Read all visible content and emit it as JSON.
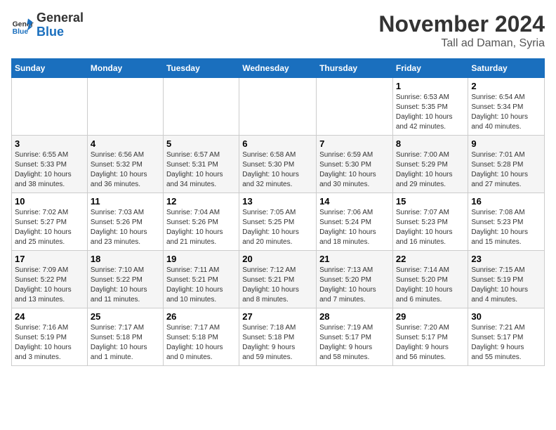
{
  "logo": {
    "line1": "General",
    "line2": "Blue"
  },
  "title": "November 2024",
  "subtitle": "Tall ad Daman, Syria",
  "days_of_week": [
    "Sunday",
    "Monday",
    "Tuesday",
    "Wednesday",
    "Thursday",
    "Friday",
    "Saturday"
  ],
  "weeks": [
    [
      {
        "day": "",
        "info": ""
      },
      {
        "day": "",
        "info": ""
      },
      {
        "day": "",
        "info": ""
      },
      {
        "day": "",
        "info": ""
      },
      {
        "day": "",
        "info": ""
      },
      {
        "day": "1",
        "info": "Sunrise: 6:53 AM\nSunset: 5:35 PM\nDaylight: 10 hours\nand 42 minutes."
      },
      {
        "day": "2",
        "info": "Sunrise: 6:54 AM\nSunset: 5:34 PM\nDaylight: 10 hours\nand 40 minutes."
      }
    ],
    [
      {
        "day": "3",
        "info": "Sunrise: 6:55 AM\nSunset: 5:33 PM\nDaylight: 10 hours\nand 38 minutes."
      },
      {
        "day": "4",
        "info": "Sunrise: 6:56 AM\nSunset: 5:32 PM\nDaylight: 10 hours\nand 36 minutes."
      },
      {
        "day": "5",
        "info": "Sunrise: 6:57 AM\nSunset: 5:31 PM\nDaylight: 10 hours\nand 34 minutes."
      },
      {
        "day": "6",
        "info": "Sunrise: 6:58 AM\nSunset: 5:30 PM\nDaylight: 10 hours\nand 32 minutes."
      },
      {
        "day": "7",
        "info": "Sunrise: 6:59 AM\nSunset: 5:30 PM\nDaylight: 10 hours\nand 30 minutes."
      },
      {
        "day": "8",
        "info": "Sunrise: 7:00 AM\nSunset: 5:29 PM\nDaylight: 10 hours\nand 29 minutes."
      },
      {
        "day": "9",
        "info": "Sunrise: 7:01 AM\nSunset: 5:28 PM\nDaylight: 10 hours\nand 27 minutes."
      }
    ],
    [
      {
        "day": "10",
        "info": "Sunrise: 7:02 AM\nSunset: 5:27 PM\nDaylight: 10 hours\nand 25 minutes."
      },
      {
        "day": "11",
        "info": "Sunrise: 7:03 AM\nSunset: 5:26 PM\nDaylight: 10 hours\nand 23 minutes."
      },
      {
        "day": "12",
        "info": "Sunrise: 7:04 AM\nSunset: 5:26 PM\nDaylight: 10 hours\nand 21 minutes."
      },
      {
        "day": "13",
        "info": "Sunrise: 7:05 AM\nSunset: 5:25 PM\nDaylight: 10 hours\nand 20 minutes."
      },
      {
        "day": "14",
        "info": "Sunrise: 7:06 AM\nSunset: 5:24 PM\nDaylight: 10 hours\nand 18 minutes."
      },
      {
        "day": "15",
        "info": "Sunrise: 7:07 AM\nSunset: 5:23 PM\nDaylight: 10 hours\nand 16 minutes."
      },
      {
        "day": "16",
        "info": "Sunrise: 7:08 AM\nSunset: 5:23 PM\nDaylight: 10 hours\nand 15 minutes."
      }
    ],
    [
      {
        "day": "17",
        "info": "Sunrise: 7:09 AM\nSunset: 5:22 PM\nDaylight: 10 hours\nand 13 minutes."
      },
      {
        "day": "18",
        "info": "Sunrise: 7:10 AM\nSunset: 5:22 PM\nDaylight: 10 hours\nand 11 minutes."
      },
      {
        "day": "19",
        "info": "Sunrise: 7:11 AM\nSunset: 5:21 PM\nDaylight: 10 hours\nand 10 minutes."
      },
      {
        "day": "20",
        "info": "Sunrise: 7:12 AM\nSunset: 5:21 PM\nDaylight: 10 hours\nand 8 minutes."
      },
      {
        "day": "21",
        "info": "Sunrise: 7:13 AM\nSunset: 5:20 PM\nDaylight: 10 hours\nand 7 minutes."
      },
      {
        "day": "22",
        "info": "Sunrise: 7:14 AM\nSunset: 5:20 PM\nDaylight: 10 hours\nand 6 minutes."
      },
      {
        "day": "23",
        "info": "Sunrise: 7:15 AM\nSunset: 5:19 PM\nDaylight: 10 hours\nand 4 minutes."
      }
    ],
    [
      {
        "day": "24",
        "info": "Sunrise: 7:16 AM\nSunset: 5:19 PM\nDaylight: 10 hours\nand 3 minutes."
      },
      {
        "day": "25",
        "info": "Sunrise: 7:17 AM\nSunset: 5:18 PM\nDaylight: 10 hours\nand 1 minute."
      },
      {
        "day": "26",
        "info": "Sunrise: 7:17 AM\nSunset: 5:18 PM\nDaylight: 10 hours\nand 0 minutes."
      },
      {
        "day": "27",
        "info": "Sunrise: 7:18 AM\nSunset: 5:18 PM\nDaylight: 9 hours\nand 59 minutes."
      },
      {
        "day": "28",
        "info": "Sunrise: 7:19 AM\nSunset: 5:17 PM\nDaylight: 9 hours\nand 58 minutes."
      },
      {
        "day": "29",
        "info": "Sunrise: 7:20 AM\nSunset: 5:17 PM\nDaylight: 9 hours\nand 56 minutes."
      },
      {
        "day": "30",
        "info": "Sunrise: 7:21 AM\nSunset: 5:17 PM\nDaylight: 9 hours\nand 55 minutes."
      }
    ]
  ]
}
